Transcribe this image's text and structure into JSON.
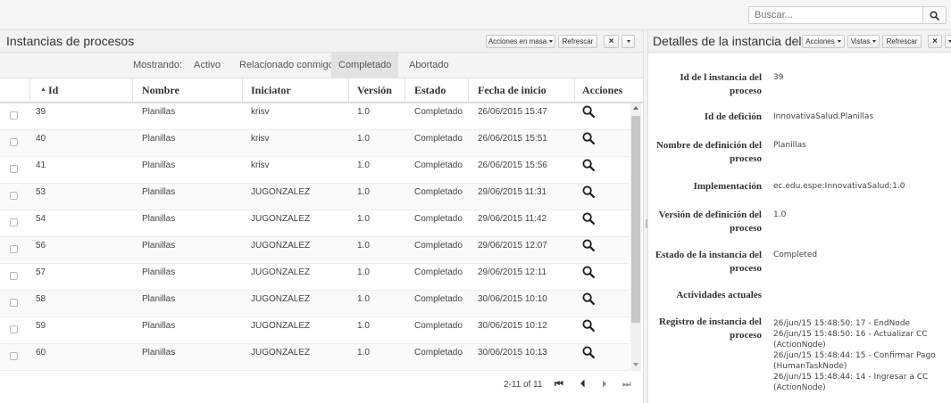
{
  "search": {
    "placeholder": "Buscar..."
  },
  "left_panel": {
    "title": "Instancias de procesos",
    "buttons": {
      "bulk_actions": "Acciones en masa",
      "refresh": "Refrescar"
    },
    "filter": {
      "label": "Mostrando:",
      "options": [
        "Activo",
        "Relacionado conmigo",
        "Completado",
        "Abortado"
      ],
      "selected": "Completado"
    },
    "table": {
      "sort_indicator": "▲",
      "columns": [
        "Id",
        "Nombre",
        "Iniciator",
        "Versión",
        "Estado",
        "Fecha de inicio",
        "Acciones"
      ],
      "rows": [
        [
          "39",
          "Planillas",
          "krisv",
          "1.0",
          "Completado",
          "26/06/2015 15:47"
        ],
        [
          "40",
          "Planillas",
          "krisv",
          "1.0",
          "Completado",
          "26/06/2015 15:51"
        ],
        [
          "41",
          "Planillas",
          "krisv",
          "1.0",
          "Completado",
          "26/06/2015 15:56"
        ],
        [
          "53",
          "Planillas",
          "JUGONZALEZ",
          "1.0",
          "Completado",
          "29/06/2015 11:31"
        ],
        [
          "54",
          "Planillas",
          "JUGONZALEZ",
          "1.0",
          "Completado",
          "29/06/2015 11:42"
        ],
        [
          "56",
          "Planillas",
          "JUGONZALEZ",
          "1.0",
          "Completado",
          "29/06/2015 12:07"
        ],
        [
          "57",
          "Planillas",
          "JUGONZALEZ",
          "1.0",
          "Completado",
          "29/06/2015 12:11"
        ],
        [
          "58",
          "Planillas",
          "JUGONZALEZ",
          "1.0",
          "Completado",
          "30/06/2015 10:10"
        ],
        [
          "59",
          "Planillas",
          "JUGONZALEZ",
          "1.0",
          "Completado",
          "30/06/2015 10:12"
        ],
        [
          "60",
          "Planillas",
          "JUGONZALEZ",
          "1.0",
          "Completado",
          "30/06/2015 10:13"
        ]
      ]
    },
    "pager": {
      "text": "2-11 of 11"
    }
  },
  "right_panel": {
    "title": "Detalles de la instancia del ...",
    "buttons": {
      "actions": "Acciones",
      "views": "Vistas",
      "refresh": "Refrescar"
    },
    "details": [
      {
        "label": "Id de l instancia del proceso",
        "value": "39"
      },
      {
        "label": "Id de defición",
        "value": "InnovativaSalud.Planillas"
      },
      {
        "label": "Nombre de definición del proceso",
        "value": "Planillas"
      },
      {
        "label": "Implementación",
        "value": "ec.edu.espe:InnovativaSalud:1.0"
      },
      {
        "label": "Versión de definición del proceso",
        "value": "1.0"
      },
      {
        "label": "Estado de la instancia del proceso",
        "value": "Completed"
      },
      {
        "label": "Actividades actuales",
        "value": ""
      },
      {
        "label": "Registro de instancia del proceso",
        "value": "26/jun/15 15:48:50: 17 - EndNode\n26/jun/15 15:48:50: 16 - Actualizar CC (ActionNode)\n26/jun/15 15:48:44: 15 - Confirmar Pago (HumanTaskNode)\n26/jun/15 15:48:44: 14 - Ingresar a CC (ActionNode)"
      }
    ]
  },
  "colors": {
    "panel_header_bg": "#f2f2f2",
    "active_filter_bg": "#e2e2e2",
    "scroll_thumb": "#c6c6c6"
  }
}
